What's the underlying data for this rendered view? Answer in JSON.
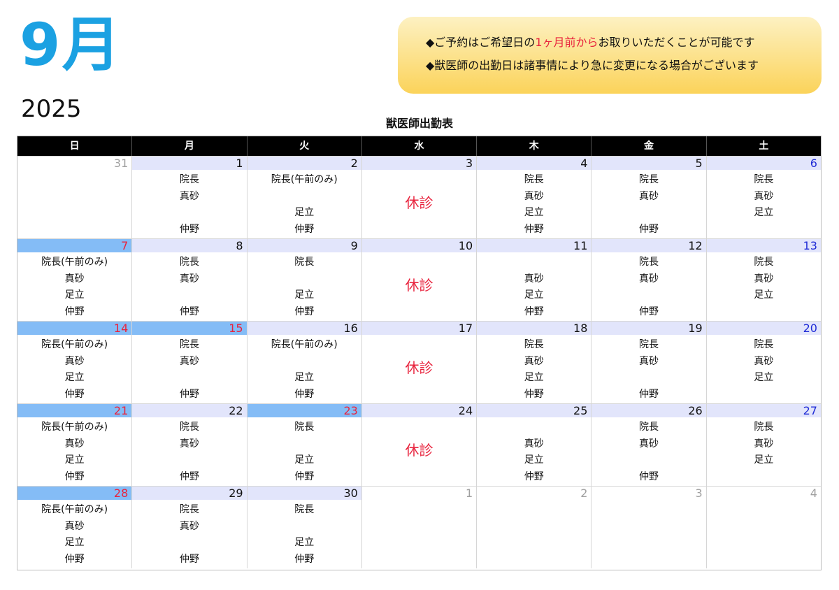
{
  "header": {
    "month": "9月",
    "year": "2025",
    "title": "獣医師出勤表"
  },
  "notice": {
    "line1_pre": "◆ご予約はご希望日の",
    "line1_red": "1ヶ月前から",
    "line1_post": "お取りいただくことが可能です",
    "line2": "◆獣医師の出勤日は諸事情により急に変更になる場合がございます"
  },
  "weekdays": [
    "日",
    "月",
    "火",
    "水",
    "木",
    "金",
    "土"
  ],
  "colors": {
    "month": "#1ba1e2",
    "holiday_bg": "#84bcf6",
    "holiday_text": "#e8233d",
    "saturday_text": "#1f2bd6",
    "weekday_bg": "#e2e5fb"
  },
  "weeks": [
    [
      {
        "day": "31",
        "type": "other",
        "staff": []
      },
      {
        "day": "1",
        "type": "normal",
        "staff": [
          "院長",
          "真砂",
          "",
          "仲野"
        ]
      },
      {
        "day": "2",
        "type": "normal",
        "staff": [
          "院長(午前のみ)",
          "",
          "足立",
          "仲野"
        ]
      },
      {
        "day": "3",
        "type": "normal",
        "closed": "休診"
      },
      {
        "day": "4",
        "type": "normal",
        "staff": [
          "院長",
          "真砂",
          "足立",
          "仲野"
        ]
      },
      {
        "day": "5",
        "type": "normal",
        "staff": [
          "院長",
          "真砂",
          "",
          "仲野"
        ]
      },
      {
        "day": "6",
        "type": "sat",
        "staff": [
          "院長",
          "真砂",
          "足立"
        ]
      }
    ],
    [
      {
        "day": "7",
        "type": "holiday",
        "staff": [
          "院長(午前のみ)",
          "真砂",
          "足立",
          "仲野"
        ]
      },
      {
        "day": "8",
        "type": "normal",
        "staff": [
          "院長",
          "真砂",
          "",
          "仲野"
        ]
      },
      {
        "day": "9",
        "type": "normal",
        "staff": [
          "院長",
          "",
          "足立",
          "仲野"
        ]
      },
      {
        "day": "10",
        "type": "normal",
        "closed": "休診"
      },
      {
        "day": "11",
        "type": "normal",
        "staff": [
          "",
          "真砂",
          "足立",
          "仲野"
        ]
      },
      {
        "day": "12",
        "type": "normal",
        "staff": [
          "院長",
          "真砂",
          "",
          "仲野"
        ]
      },
      {
        "day": "13",
        "type": "sat",
        "staff": [
          "院長",
          "真砂",
          "足立"
        ]
      }
    ],
    [
      {
        "day": "14",
        "type": "holiday",
        "staff": [
          "院長(午前のみ)",
          "真砂",
          "足立",
          "仲野"
        ]
      },
      {
        "day": "15",
        "type": "holiday",
        "staff": [
          "院長",
          "真砂",
          "",
          "仲野"
        ]
      },
      {
        "day": "16",
        "type": "normal",
        "staff": [
          "院長(午前のみ)",
          "",
          "足立",
          "仲野"
        ]
      },
      {
        "day": "17",
        "type": "normal",
        "closed": "休診"
      },
      {
        "day": "18",
        "type": "normal",
        "staff": [
          "院長",
          "真砂",
          "足立",
          "仲野"
        ]
      },
      {
        "day": "19",
        "type": "normal",
        "staff": [
          "院長",
          "真砂",
          "",
          "仲野"
        ]
      },
      {
        "day": "20",
        "type": "sat",
        "staff": [
          "院長",
          "真砂",
          "足立"
        ]
      }
    ],
    [
      {
        "day": "21",
        "type": "holiday",
        "staff": [
          "院長(午前のみ)",
          "真砂",
          "足立",
          "仲野"
        ]
      },
      {
        "day": "22",
        "type": "normal",
        "staff": [
          "院長",
          "真砂",
          "",
          "仲野"
        ]
      },
      {
        "day": "23",
        "type": "holiday",
        "staff": [
          "院長",
          "",
          "足立",
          "仲野"
        ]
      },
      {
        "day": "24",
        "type": "normal",
        "closed": "休診"
      },
      {
        "day": "25",
        "type": "normal",
        "staff": [
          "",
          "真砂",
          "足立",
          "仲野"
        ]
      },
      {
        "day": "26",
        "type": "normal",
        "staff": [
          "院長",
          "真砂",
          "",
          "仲野"
        ]
      },
      {
        "day": "27",
        "type": "sat",
        "staff": [
          "院長",
          "真砂",
          "足立"
        ]
      }
    ],
    [
      {
        "day": "28",
        "type": "holiday",
        "staff": [
          "院長(午前のみ)",
          "真砂",
          "足立",
          "仲野"
        ]
      },
      {
        "day": "29",
        "type": "normal",
        "staff": [
          "院長",
          "真砂",
          "",
          "仲野"
        ]
      },
      {
        "day": "30",
        "type": "normal",
        "staff": [
          "院長",
          "",
          "足立",
          "仲野"
        ]
      },
      {
        "day": "1",
        "type": "other",
        "staff": []
      },
      {
        "day": "2",
        "type": "other",
        "staff": []
      },
      {
        "day": "3",
        "type": "other",
        "staff": []
      },
      {
        "day": "4",
        "type": "other",
        "staff": []
      }
    ]
  ]
}
